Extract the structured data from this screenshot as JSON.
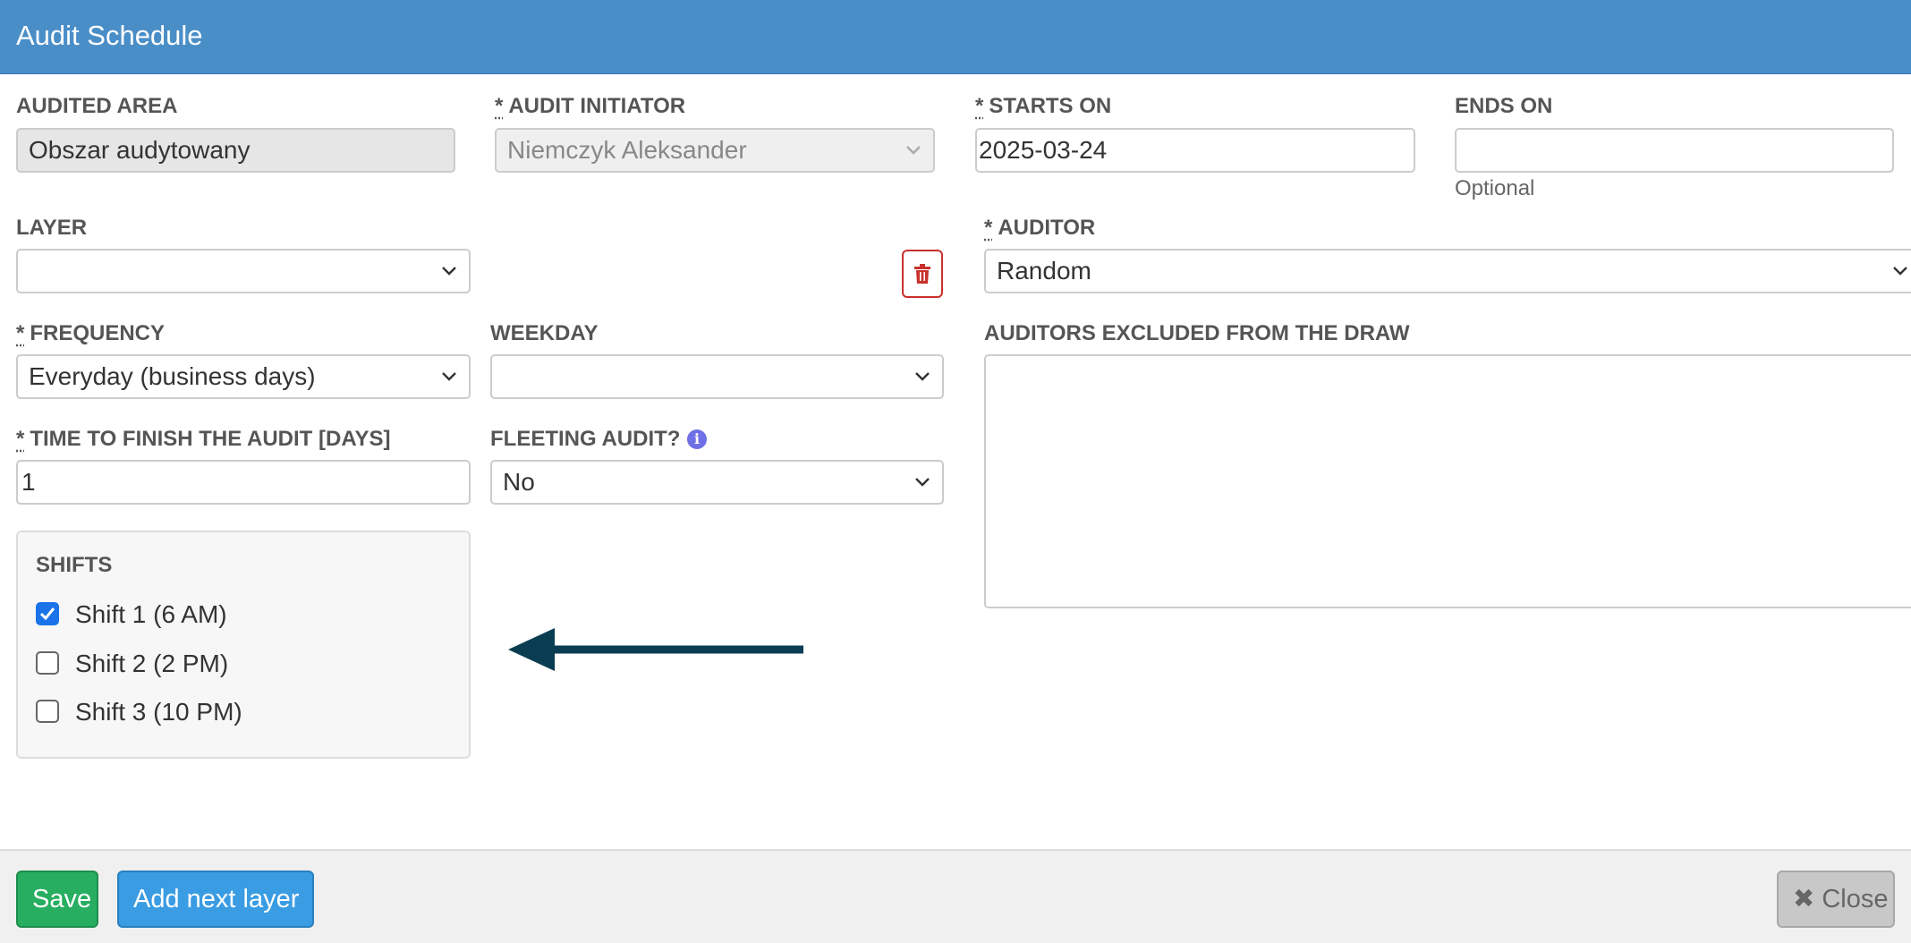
{
  "header": {
    "title": "Audit Schedule"
  },
  "form": {
    "audited_area": {
      "label": "AUDITED AREA",
      "value": "Obszar audytowany"
    },
    "audit_initiator": {
      "required_mark": "*",
      "label": "AUDIT INITIATOR",
      "value": "Niemczyk Aleksander"
    },
    "starts_on": {
      "required_mark": "*",
      "label": "STARTS ON",
      "value": "2025-03-24"
    },
    "ends_on": {
      "label": "ENDS ON",
      "value": "",
      "help": "Optional"
    },
    "layer": {
      "label": "LAYER",
      "value": ""
    },
    "auditor": {
      "required_mark": "*",
      "label": "AUDITOR",
      "value": "Random"
    },
    "frequency": {
      "required_mark": "*",
      "label": "FREQUENCY",
      "value": "Everyday (business days)"
    },
    "weekday": {
      "label": "WEEKDAY",
      "value": ""
    },
    "excluded_auditors": {
      "label": "AUDITORS EXCLUDED FROM THE DRAW"
    },
    "time_to_finish": {
      "required_mark": "*",
      "label": "TIME TO FINISH THE AUDIT [DAYS]",
      "value": "1"
    },
    "fleeting_audit": {
      "label": "FLEETING AUDIT?",
      "value": "No",
      "icon": "info-icon"
    },
    "shifts": {
      "label": "SHIFTS",
      "items": [
        {
          "label": "Shift 1 (6 AM)",
          "checked": true
        },
        {
          "label": "Shift 2 (2 PM)",
          "checked": false
        },
        {
          "label": "Shift 3 (10 PM)",
          "checked": false
        }
      ]
    }
  },
  "footer": {
    "save_label": "Save",
    "add_layer_label": "Add next layer",
    "close_label": "Close",
    "close_icon": "✖"
  },
  "colors": {
    "header": "#4a8ec8",
    "save": "#27ae60",
    "add_layer": "#3a9ce2",
    "delete": "#c9302c",
    "arrow": "#0b3d52",
    "info": "#6f6fe6"
  }
}
